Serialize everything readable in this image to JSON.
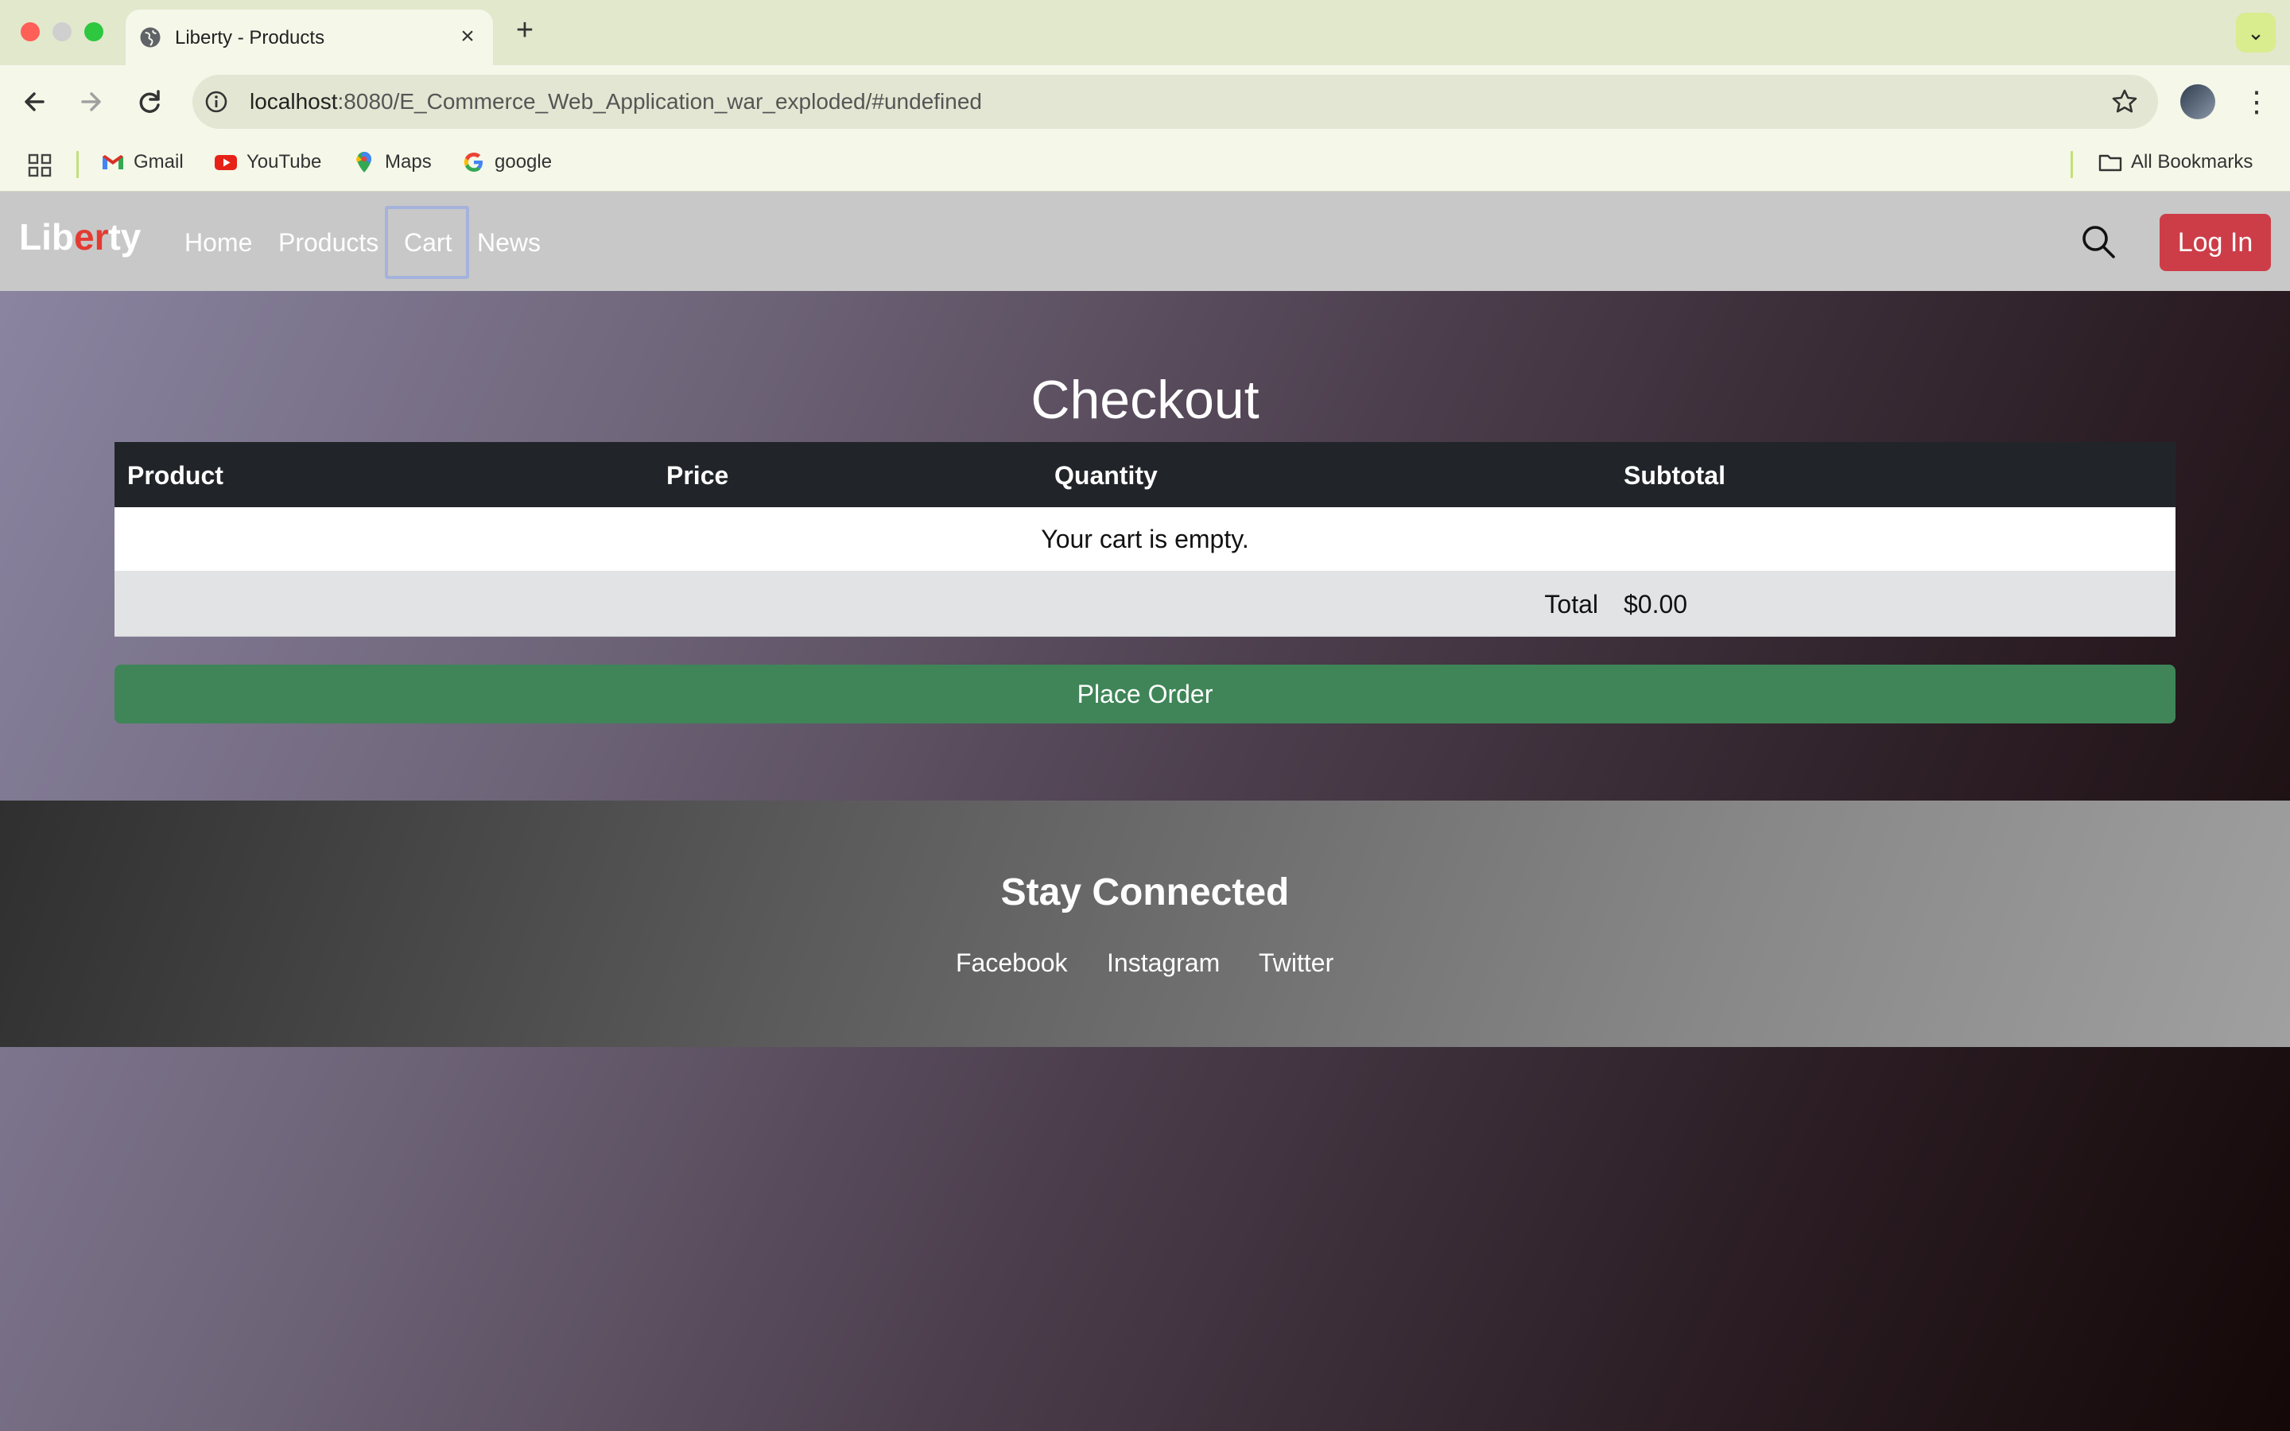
{
  "browser": {
    "tab_title": "Liberty - Products",
    "tab_close": "×",
    "new_tab": "+",
    "tab_menu": "⌄",
    "url_host": "localhost",
    "url_path": ":8080/E_Commerce_Web_Application_war_exploded/#undefined",
    "bookmarks": [
      "Gmail",
      "YouTube",
      "Maps",
      "google"
    ],
    "all_bookmarks": "All Bookmarks"
  },
  "site": {
    "logo_a": "Lib",
    "logo_b": "er",
    "logo_c": "ty",
    "nav": [
      "Home",
      "Products",
      "Cart",
      "News"
    ],
    "login": "Log In",
    "accent": "#cd3d48"
  },
  "checkout": {
    "title": "Checkout",
    "columns": [
      "Product",
      "Price",
      "Quantity",
      "Subtotal"
    ],
    "empty_message": "Your cart is empty.",
    "total_label": "Total",
    "total_value": "$0.00",
    "place_order": "Place Order"
  },
  "footer": {
    "title": "Stay Connected",
    "links": [
      "Facebook",
      "Instagram",
      "Twitter"
    ]
  }
}
